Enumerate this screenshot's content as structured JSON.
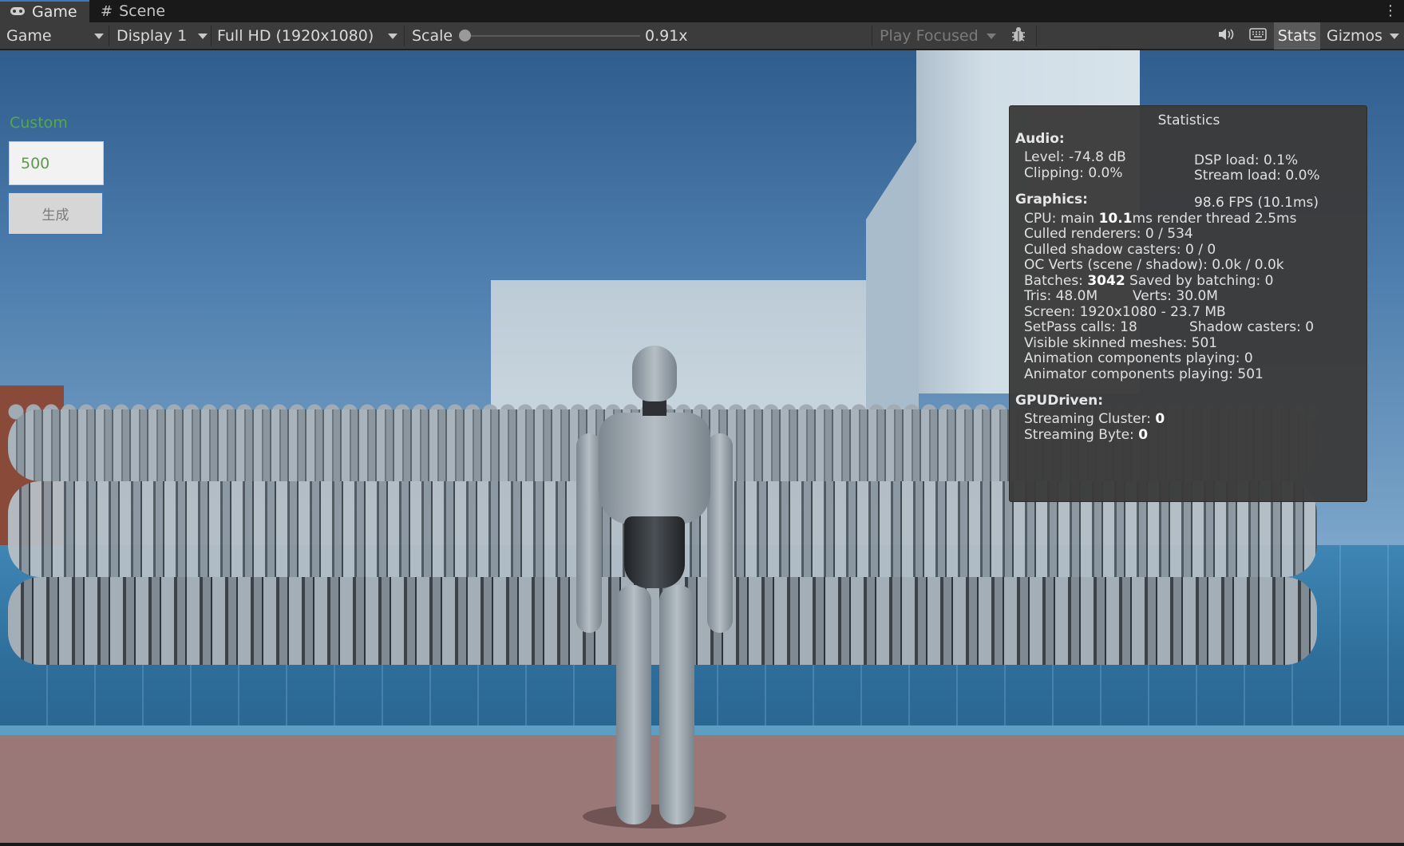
{
  "tabs": [
    {
      "label": "Game",
      "icon": "gamepad-icon"
    },
    {
      "label": "Scene",
      "icon": "hash-grid-icon"
    }
  ],
  "toolbar": {
    "game_view_dropdown": "Game",
    "display_dropdown": "Display 1",
    "resolution_dropdown": "Full HD (1920x1080)",
    "scale_label": "Scale",
    "scale_value": "0.91x",
    "play_mode_dropdown": "Play Focused",
    "stats_label": "Stats",
    "gizmos_label": "Gizmos"
  },
  "game_ui": {
    "custom_label": "Custom",
    "count_value": "500",
    "generate_label": "生成"
  },
  "stats": {
    "title": "Statistics",
    "audio_header": "Audio:",
    "level": "Level: -74.8 dB",
    "clipping": "Clipping: 0.0%",
    "dsp_load": "DSP load: 0.1%",
    "stream_load": "Stream load: 0.0%",
    "graphics_header": "Graphics:",
    "fps": "98.6 FPS (10.1ms)",
    "cpu_prefix": "CPU: main ",
    "cpu_main": "10.1",
    "cpu_suffix": "ms  render thread 2.5ms",
    "culled_renderers": "Culled renderers: 0 / 534",
    "culled_shadow": "Culled shadow casters: 0 / 0",
    "oc_verts": "OC Verts (scene / shadow): 0.0k / 0.0k",
    "batches_prefix": "Batches: ",
    "batches_value": "3042",
    "batches_suffix": " Saved by batching: 0",
    "tris": "Tris: 48.0M",
    "verts": "Verts: 30.0M",
    "screen": "Screen: 1920x1080 - 23.7 MB",
    "setpass": "SetPass calls: 18",
    "shadow_casters": "Shadow casters: 0",
    "visible_skinned": "Visible skinned meshes: 501",
    "animation_playing": "Animation components playing: 0",
    "animator_playing": "Animator components playing: 501",
    "gpudriven_header": "GPUDriven:",
    "streaming_cluster_prefix": "Streaming Cluster: ",
    "streaming_cluster_value": "0",
    "streaming_byte_prefix": "Streaming Byte: ",
    "streaming_byte_value": "0"
  },
  "colors": {
    "accent": "#3a79bb",
    "custom_label": "#54a84a",
    "sky_top": "#2f5d8d",
    "floor": "#3f86b4",
    "ground": "#9b7878"
  }
}
